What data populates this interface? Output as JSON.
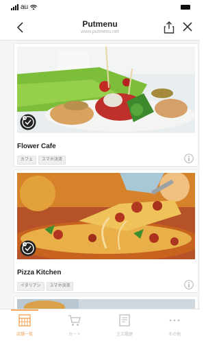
{
  "status_bar": {
    "carrier": "au"
  },
  "nav": {
    "title": "Putmenu",
    "subtitle": "www.putmenu.net"
  },
  "shops": [
    {
      "name": "Flower Cafe",
      "tags": [
        "カフェ",
        "スマホ決済"
      ]
    },
    {
      "name": "Pizza Kitchen",
      "tags": [
        "イタリアン",
        "スマホ決済"
      ]
    }
  ],
  "tabs": [
    {
      "label": "店舗一覧",
      "icon": "shop-list-icon",
      "active": true
    },
    {
      "label": "カート",
      "icon": "cart-icon",
      "active": false
    },
    {
      "label": "注文履歴",
      "icon": "order-history-icon",
      "active": false
    },
    {
      "label": "その他",
      "icon": "more-icon",
      "active": false
    }
  ],
  "colors": {
    "accent": "#f0a55a",
    "text": "#222222",
    "muted": "#bbbbbb"
  }
}
